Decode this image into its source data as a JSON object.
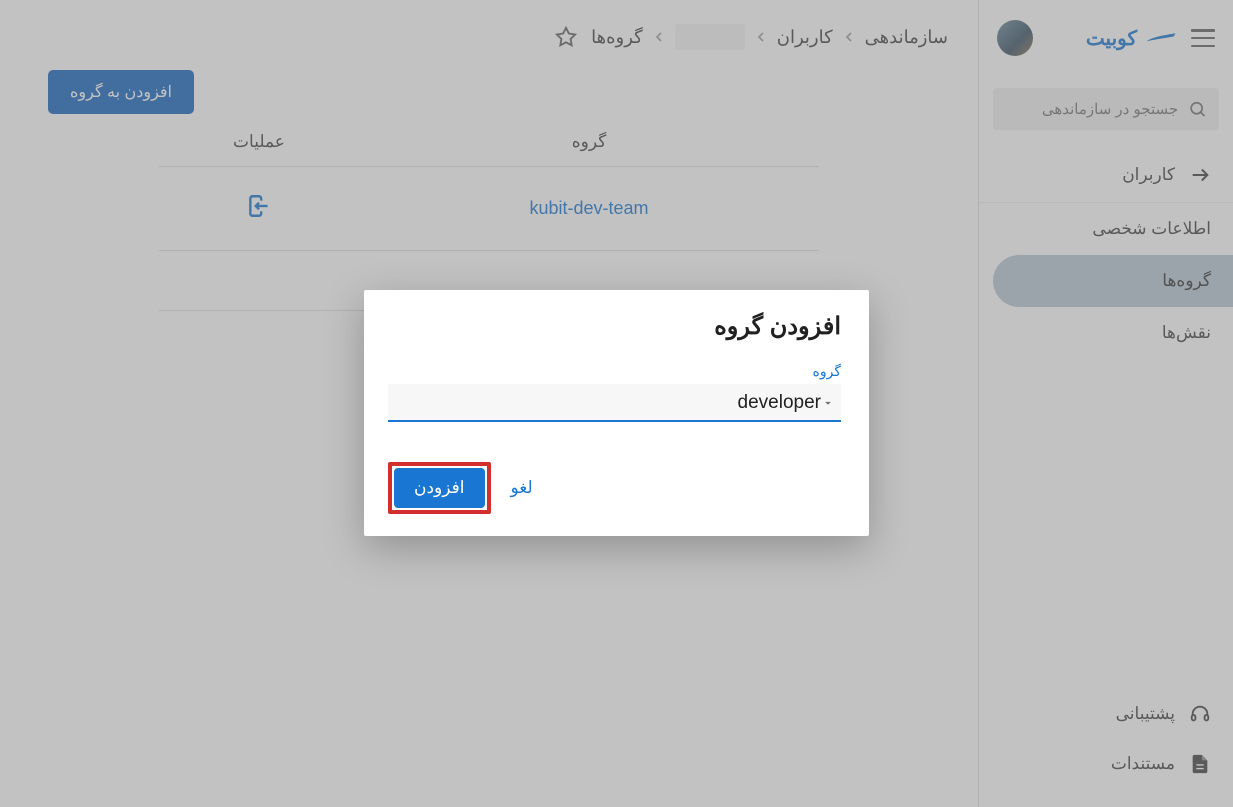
{
  "brand": "کوبیت",
  "search": {
    "placeholder": "جستجو در سازماندهی"
  },
  "sidebar": {
    "items": [
      {
        "label": "کاربران"
      },
      {
        "label": "اطلاعات شخصی"
      },
      {
        "label": "گروه‌ها"
      },
      {
        "label": "نقش‌ها"
      }
    ]
  },
  "footer": {
    "support": "پشتیبانی",
    "docs": "مستندات"
  },
  "breadcrumb": {
    "org": "سازماندهی",
    "users": "کاربران",
    "groups": "گروه‌ها"
  },
  "buttons": {
    "add_to_group": "افزودن به گروه"
  },
  "table": {
    "headers": {
      "ops": "عملیات",
      "group": "گروه"
    },
    "rows": [
      {
        "group": "kubit-dev-team"
      }
    ],
    "extra_row": true
  },
  "dialog": {
    "title": "افزودن گروه",
    "field_label": "گروه",
    "value": "developer",
    "submit": "افزودن",
    "cancel": "لغو"
  }
}
